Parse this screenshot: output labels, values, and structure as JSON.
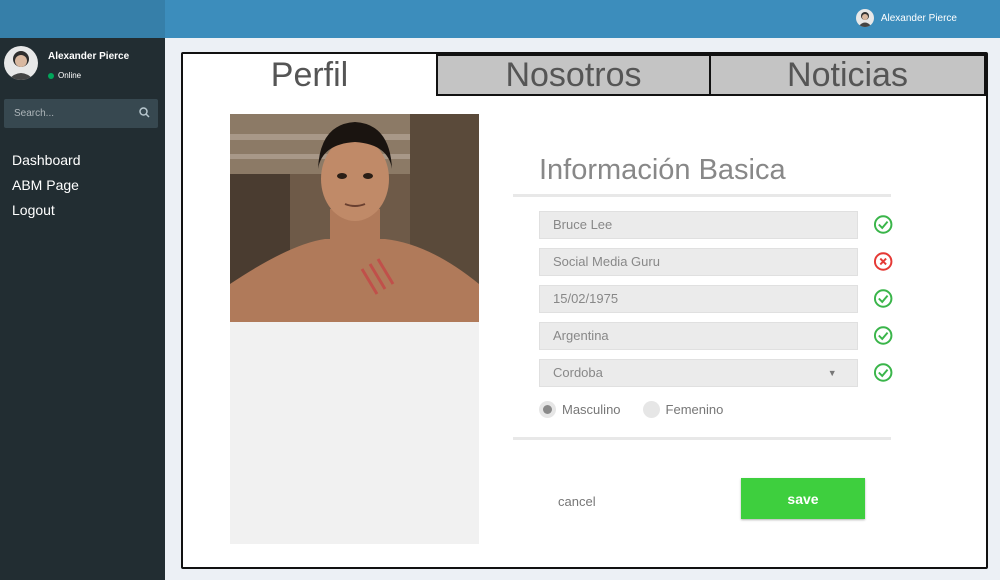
{
  "header": {
    "user_name": "Alexander Pierce"
  },
  "sidebar": {
    "user_name": "Alexander Pierce",
    "status": "Online",
    "search_placeholder": "Search...",
    "items": [
      {
        "label": "Dashboard"
      },
      {
        "label": "ABM Page"
      },
      {
        "label": "Logout"
      }
    ]
  },
  "tabs": [
    {
      "label": "Perfil",
      "active": true
    },
    {
      "label": "Nosotros",
      "active": false
    },
    {
      "label": "Noticias",
      "active": false
    }
  ],
  "form": {
    "title": "Información Basica",
    "fields": [
      {
        "value": "Bruce Lee",
        "status": "valid"
      },
      {
        "value": "Social Media Guru",
        "status": "invalid"
      },
      {
        "value": "15/02/1975",
        "status": "valid"
      },
      {
        "value": "Argentina",
        "status": "valid"
      },
      {
        "value": "Cordoba",
        "status": "valid",
        "type": "select"
      }
    ],
    "gender_options": [
      {
        "label": "Masculino",
        "selected": true
      },
      {
        "label": "Femenino",
        "selected": false
      }
    ],
    "cancel_label": "cancel",
    "save_label": "save"
  },
  "colors": {
    "topbar": "#3c8dbc",
    "sidebar": "#222d32",
    "save_button": "#3ecf3e",
    "valid": "#3ab54a",
    "invalid": "#e53935"
  }
}
